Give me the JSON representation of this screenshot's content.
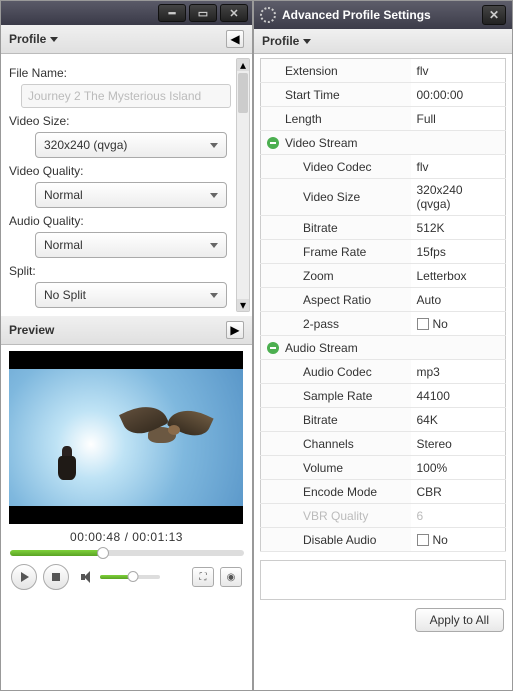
{
  "left": {
    "profile_header": "Profile",
    "file_name_label": "File Name:",
    "file_name_value": "Journey 2 The Mysterious Island",
    "video_size_label": "Video Size:",
    "video_size_value": "320x240 (qvga)",
    "video_quality_label": "Video Quality:",
    "video_quality_value": "Normal",
    "audio_quality_label": "Audio Quality:",
    "audio_quality_value": "Normal",
    "split_label": "Split:",
    "split_value": "No Split",
    "preview_header": "Preview",
    "time_current": "00:00:48",
    "time_sep": " / ",
    "time_total": "00:01:13"
  },
  "right": {
    "title": "Advanced Profile Settings",
    "profile_header": "Profile",
    "rows": {
      "extension_label": "Extension",
      "extension_value": "flv",
      "start_time_label": "Start Time",
      "start_time_value": "00:00:00",
      "length_label": "Length",
      "length_value": "Full",
      "video_stream_label": "Video Stream",
      "video_codec_label": "Video Codec",
      "video_codec_value": "flv",
      "video_size_label": "Video Size",
      "video_size_value": "320x240 (qvga)",
      "bitrate_label": "Bitrate",
      "bitrate_value": "512K",
      "frame_rate_label": "Frame Rate",
      "frame_rate_value": "15fps",
      "zoom_label": "Zoom",
      "zoom_value": "Letterbox",
      "aspect_ratio_label": "Aspect Ratio",
      "aspect_ratio_value": "Auto",
      "two_pass_label": "2-pass",
      "two_pass_value": "No",
      "audio_stream_label": "Audio Stream",
      "audio_codec_label": "Audio Codec",
      "audio_codec_value": "mp3",
      "sample_rate_label": "Sample Rate",
      "sample_rate_value": "44100",
      "abitrate_label": "Bitrate",
      "abitrate_value": "64K",
      "channels_label": "Channels",
      "channels_value": "Stereo",
      "volume_label": "Volume",
      "volume_value": "100%",
      "encode_mode_label": "Encode Mode",
      "encode_mode_value": "CBR",
      "vbr_quality_label": "VBR Quality",
      "vbr_quality_value": "6",
      "disable_audio_label": "Disable Audio",
      "disable_audio_value": "No"
    },
    "apply_label": "Apply to All"
  }
}
